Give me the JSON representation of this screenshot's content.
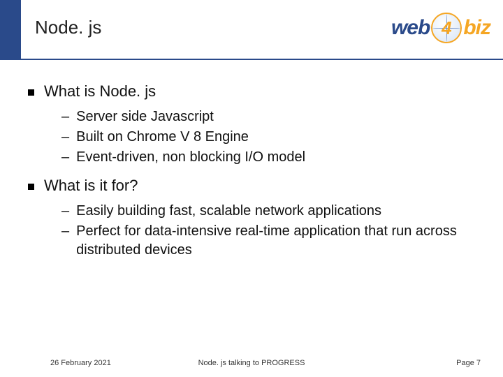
{
  "header": {
    "title": "Node. js",
    "logo": {
      "part1": "web",
      "num": "4",
      "part2": "biz"
    }
  },
  "sections": [
    {
      "heading": "What is Node. js",
      "items": [
        "Server side Javascript",
        "Built on Chrome V 8 Engine",
        "Event-driven, non blocking I/O model"
      ]
    },
    {
      "heading": "What is it for?",
      "items": [
        "Easily building fast, scalable network applications",
        "Perfect for data-intensive real-time application that run across distributed devices"
      ]
    }
  ],
  "footer": {
    "date": "26 February 2021",
    "center": "Node. js talking to PROGRESS",
    "page": "Page 7"
  }
}
